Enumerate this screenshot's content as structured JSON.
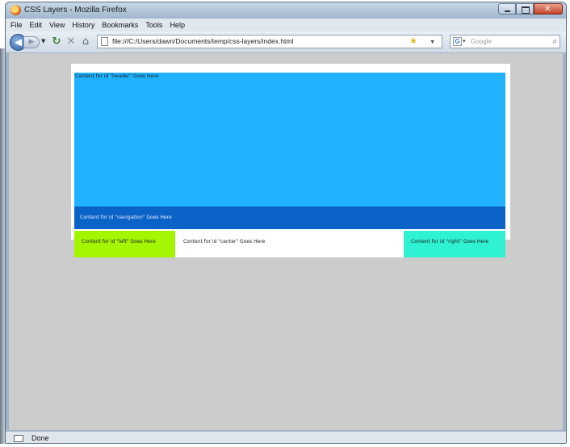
{
  "window": {
    "title": "CSS Layers - Mozilla Firefox"
  },
  "menu": [
    "File",
    "Edit",
    "View",
    "History",
    "Bookmarks",
    "Tools",
    "Help"
  ],
  "toolbar": {
    "url": "file:///C:/Users/dawn/Documents/temp/css-layers/index.html",
    "search_placeholder": "Google"
  },
  "page": {
    "header_text": "Content for id \"header\" Goes Here",
    "navigation_text": "Content for id \"navigation\" Goes Here",
    "left_text": "Content for id \"left\" Goes Here",
    "center_text": "Content for id \"center\" Goes Here",
    "right_text": "Content for id \"right\" Goes Here"
  },
  "colors": {
    "header": "#20b2fe",
    "navigation": "#0b63c7",
    "left": "#a4f500",
    "center": "#ffffff",
    "right": "#2ff2d2",
    "viewport_background": "#cccccc"
  },
  "status": {
    "text": "Done"
  }
}
